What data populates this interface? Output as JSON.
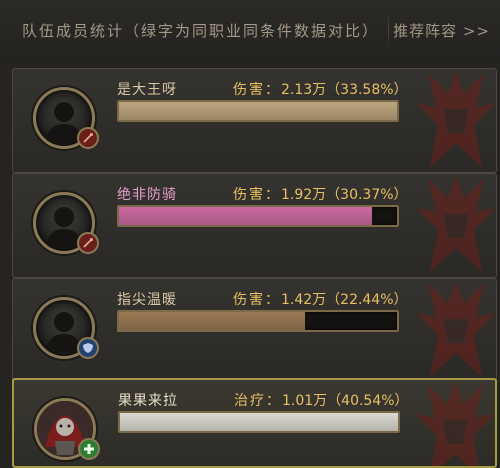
{
  "header": {
    "title": "队伍成员统计（绿字为同职业同条件数据对比）",
    "recommend_link": "推荐阵容 >>"
  },
  "members": [
    {
      "name": "是大王呀",
      "stat_label": "伤害：",
      "stat_value": "2.13万",
      "stat_percent": "（33.58%）",
      "bar_fraction": 1.0,
      "name_color": "#d9c8a4",
      "bar_color": "#bda57e",
      "role_icon": "attack-role-icon",
      "avatar_icon": "silhouette-icon"
    },
    {
      "name": "绝非防骑",
      "stat_label": "伤害：",
      "stat_value": "1.92万",
      "stat_percent": "（30.37%）",
      "bar_fraction": 0.91,
      "name_color": "#e79fc9",
      "bar_color": "#cc6aa0",
      "role_icon": "attack-role-icon",
      "avatar_icon": "silhouette-icon"
    },
    {
      "name": "指尖温暖",
      "stat_label": "伤害：",
      "stat_value": "1.42万",
      "stat_percent": "（22.44%）",
      "bar_fraction": 0.67,
      "name_color": "#d9c8a4",
      "bar_color": "#9a7a55",
      "role_icon": "shield-role-icon",
      "avatar_icon": "silhouette-icon"
    },
    {
      "name": "果果来拉",
      "stat_label": "治疗：",
      "stat_value": "1.01万",
      "stat_percent": "（40.54%）",
      "bar_fraction": 1.0,
      "name_color": "#e8dfc9",
      "bar_color": "#dcdad2",
      "role_icon": "healer-plus-icon",
      "avatar_icon": "character-portrait-icon"
    }
  ]
}
